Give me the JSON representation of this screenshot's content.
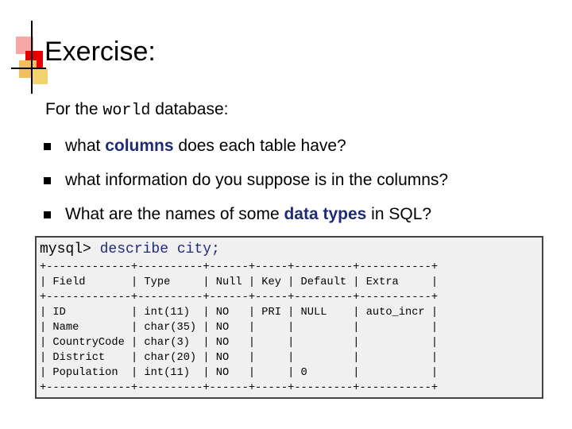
{
  "slide": {
    "title": "Exercise:",
    "intro_prefix": "For the ",
    "intro_code": "world",
    "intro_suffix": " database:"
  },
  "bullets": [
    {
      "pre": "what ",
      "highlight": "columns",
      "post": " does each table have?"
    },
    {
      "pre": "what information do you suppose is in the columns?",
      "highlight": "",
      "post": ""
    },
    {
      "pre": "What are the names of some ",
      "highlight": "data types",
      "post": " in SQL?"
    }
  ],
  "terminal": {
    "prompt": "mysql> ",
    "command": "describe city;",
    "output": "+-------------+----------+------+-----+---------+-----------+\n| Field       | Type     | Null | Key | Default | Extra     |\n+-------------+----------+------+-----+---------+-----------+\n| ID          | int(11)  | NO   | PRI | NULL    | auto_incr |\n| Name        | char(35) | NO   |     |         |           |\n| CountryCode | char(3)  | NO   |     |         |           |\n| District    | char(20) | NO   |     |         |           |\n| Population  | int(11)  | NO   |     | 0       |           |\n+-------------+----------+------+-----+---------+-----------+"
  },
  "colors": {
    "highlight": "#1f2a78",
    "terminal_bg": "#f0f0f0",
    "accent_red": "#e60000",
    "accent_pink": "#f7a7a7",
    "accent_orange": "#f3bf5e"
  }
}
